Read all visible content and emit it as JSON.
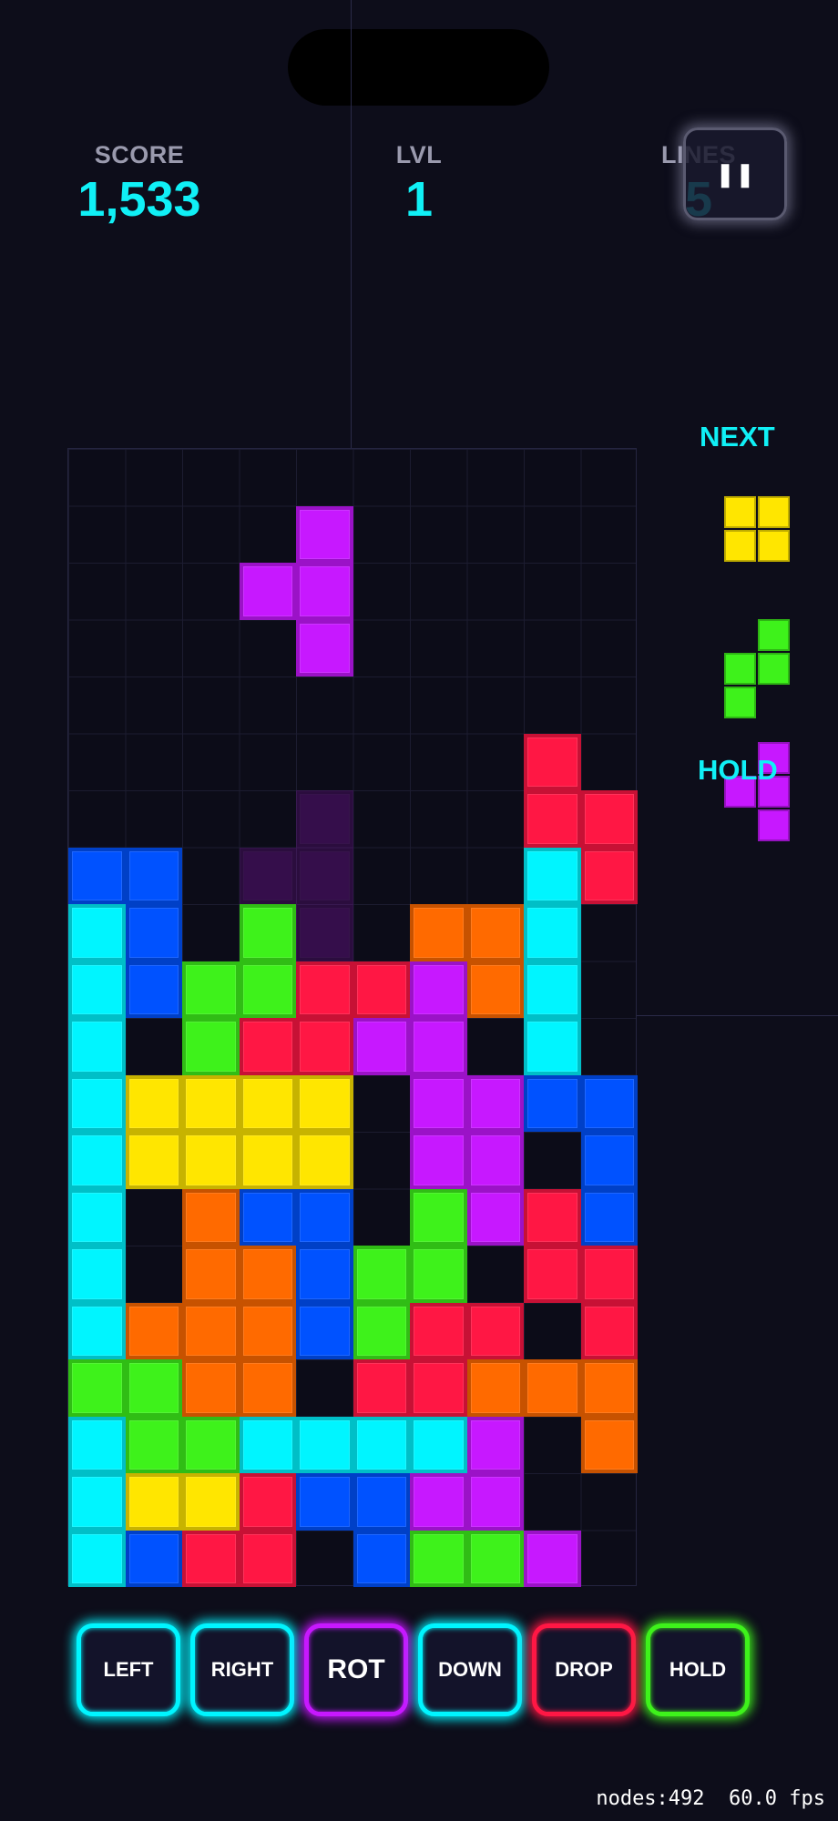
{
  "hud": {
    "score_label": "SCORE",
    "score_value": "1,533",
    "level_label": "LVL",
    "level_value": "1",
    "lines_label": "LINES",
    "lines_value": "5",
    "pause_icon": "pause-icon"
  },
  "colors": {
    "I": "#00f5ff",
    "O": "#ffe600",
    "T": "#c718ff",
    "S": "#3ef21b",
    "Z": "#ff1744",
    "J": "#0052ff",
    "L": "#ff6a00",
    "background": "#0d0d1a",
    "accent": "#10f0f6"
  },
  "board": {
    "cols": 10,
    "rows": 20,
    "rows_data": [
      "..........",
      "....T.....",
      "...TT.....",
      "....T.....",
      "..........",
      "........Z.",
      "........ZZ",
      "JJ......IZ",
      "IJ.S..LLI.",
      "IJSSZZTLI.",
      "I.SZZTT.I.",
      "IOOOO.TTJJ",
      "IOOOO.TT.J",
      "I.LJJ.STZJ",
      "I.LLJSS.ZZ",
      "ILLLJSZZ.Z",
      "SSLL.ZZLLL",
      "ISSIIIIT.L",
      "IOOZJJTT..",
      "IJZZ.JSST."
    ],
    "ghost_cells": [
      [
        4,
        6
      ],
      [
        3,
        7
      ],
      [
        4,
        7
      ],
      [
        4,
        8
      ]
    ]
  },
  "next": {
    "label": "NEXT",
    "pieces": [
      {
        "type": "O",
        "color": "#ffe600"
      },
      {
        "type": "S",
        "color": "#3ef21b"
      }
    ]
  },
  "hold": {
    "label": "HOLD",
    "piece": {
      "type": "T",
      "color": "#c718ff"
    }
  },
  "controls": [
    {
      "id": "left",
      "label": "LEFT",
      "color": "#00f5ff"
    },
    {
      "id": "right",
      "label": "RIGHT",
      "color": "#00f5ff"
    },
    {
      "id": "rot",
      "label": "ROT",
      "color": "#c718ff"
    },
    {
      "id": "down",
      "label": "DOWN",
      "color": "#00f5ff"
    },
    {
      "id": "drop",
      "label": "DROP",
      "color": "#ff1744"
    },
    {
      "id": "hold",
      "label": "HOLD",
      "color": "#3ef21b"
    }
  ],
  "perf": {
    "text": "nodes:492  60.0 fps"
  }
}
